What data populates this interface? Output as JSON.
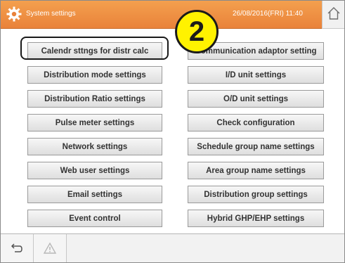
{
  "header": {
    "title": "System settings",
    "datetime": "26/08/2016(FRI) 11:40",
    "icons": [
      "gear-icon",
      "home-icon"
    ],
    "accent_color": "#e9823a"
  },
  "callout": {
    "number": "2",
    "color": "#fff200"
  },
  "buttons_left": [
    "Calendr sttngs for distr calc",
    "Distribution mode settings",
    "Distribution Ratio settings",
    "Pulse meter settings",
    "Network settings",
    "Web user settings",
    "Email settings",
    "Event control"
  ],
  "buttons_right": [
    "Communication adaptor setting",
    "I/D unit settings",
    "O/D unit settings",
    "Check configuration",
    "Schedule group name settings",
    "Area group name settings",
    "Distribution group settings",
    "Hybrid GHP/EHP settings"
  ],
  "footer": {
    "icons": [
      "back-icon",
      "warning-icon"
    ]
  }
}
